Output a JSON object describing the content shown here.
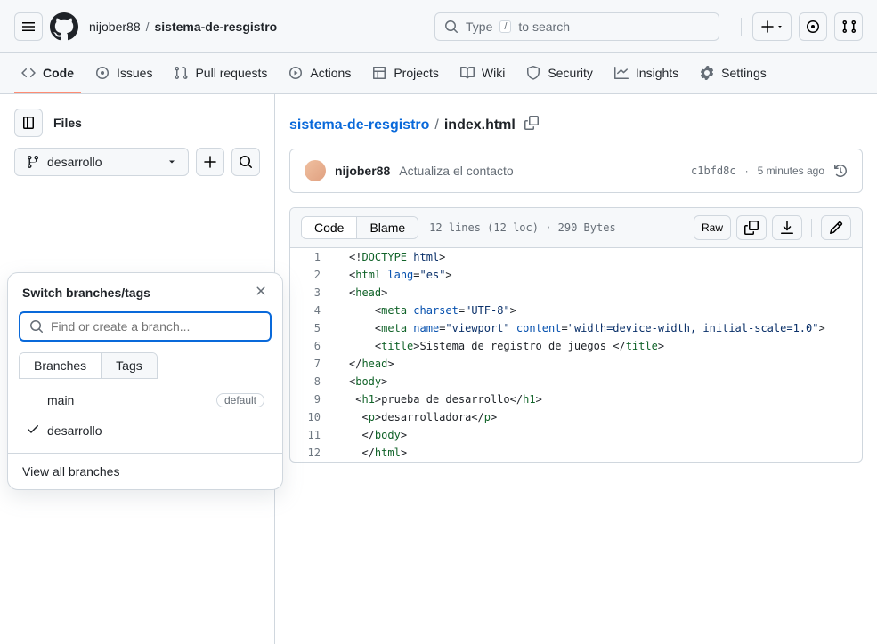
{
  "header": {
    "owner": "nijober88",
    "repo": "sistema-de-resgistro",
    "search_prefix": "Type",
    "search_key": "/",
    "search_suffix": "to search"
  },
  "nav": {
    "code": "Code",
    "issues": "Issues",
    "pulls": "Pull requests",
    "actions": "Actions",
    "projects": "Projects",
    "wiki": "Wiki",
    "security": "Security",
    "insights": "Insights",
    "settings": "Settings"
  },
  "sidebar": {
    "files_label": "Files",
    "current_branch": "desarrollo"
  },
  "branch_popup": {
    "title": "Switch branches/tags",
    "search_placeholder": "Find or create a branch...",
    "tab_branches": "Branches",
    "tab_tags": "Tags",
    "branches": [
      {
        "name": "main",
        "default": true,
        "checked": false
      },
      {
        "name": "desarrollo",
        "default": false,
        "checked": true
      }
    ],
    "default_label": "default",
    "view_all": "View all branches"
  },
  "file": {
    "repo_link": "sistema-de-resgistro",
    "filename": "index.html"
  },
  "commit": {
    "author": "nijober88",
    "message": "Actualiza el contacto",
    "sha": "c1bfd8c",
    "time_sep": " · ",
    "time": "5 minutes ago"
  },
  "code_toolbar": {
    "code_tab": "Code",
    "blame_tab": "Blame",
    "file_info": "12 lines (12 loc) · 290 Bytes",
    "raw": "Raw"
  },
  "code_lines": [
    {
      "n": 1,
      "html": "<span class='pl-kos'>&lt;!</span><span class='pl-ent'>DOCTYPE</span> <span class='pl-s'>html</span><span class='pl-kos'>&gt;</span>"
    },
    {
      "n": 2,
      "html": "<span class='pl-kos'>&lt;</span><span class='pl-ent'>html</span> <span class='pl-c1'>lang</span>=<span class='pl-s'>\"es\"</span><span class='pl-kos'>&gt;</span>"
    },
    {
      "n": 3,
      "html": "<span class='pl-kos'>&lt;</span><span class='pl-ent'>head</span><span class='pl-kos'>&gt;</span>"
    },
    {
      "n": 4,
      "html": "    <span class='pl-kos'>&lt;</span><span class='pl-ent'>meta</span> <span class='pl-c1'>charset</span>=<span class='pl-s'>\"UTF-8\"</span><span class='pl-kos'>&gt;</span>"
    },
    {
      "n": 5,
      "html": "    <span class='pl-kos'>&lt;</span><span class='pl-ent'>meta</span> <span class='pl-c1'>name</span>=<span class='pl-s'>\"viewport\"</span> <span class='pl-c1'>content</span>=<span class='pl-s'>\"width=device-width, initial-scale=1.0\"</span><span class='pl-kos'>&gt;</span>"
    },
    {
      "n": 6,
      "html": "    <span class='pl-kos'>&lt;</span><span class='pl-ent'>title</span><span class='pl-kos'>&gt;</span>Sistema de registro de juegos <span class='pl-kos'>&lt;/</span><span class='pl-ent'>title</span><span class='pl-kos'>&gt;</span>"
    },
    {
      "n": 7,
      "html": "<span class='pl-kos'>&lt;/</span><span class='pl-ent'>head</span><span class='pl-kos'>&gt;</span>"
    },
    {
      "n": 8,
      "html": "<span class='pl-kos'>&lt;</span><span class='pl-ent'>body</span><span class='pl-kos'>&gt;</span>"
    },
    {
      "n": 9,
      "html": " <span class='pl-kos'>&lt;</span><span class='pl-ent'>h1</span><span class='pl-kos'>&gt;</span>prueba de desarrollo<span class='pl-kos'>&lt;/</span><span class='pl-ent'>h1</span><span class='pl-kos'>&gt;</span>"
    },
    {
      "n": 10,
      "html": "  <span class='pl-kos'>&lt;</span><span class='pl-ent'>p</span><span class='pl-kos'>&gt;</span>desarrolladora<span class='pl-kos'>&lt;/</span><span class='pl-ent'>p</span><span class='pl-kos'>&gt;</span>"
    },
    {
      "n": 11,
      "html": "  <span class='pl-kos'>&lt;/</span><span class='pl-ent'>body</span><span class='pl-kos'>&gt;</span>"
    },
    {
      "n": 12,
      "html": "  <span class='pl-kos'>&lt;/</span><span class='pl-ent'>html</span><span class='pl-kos'>&gt;</span>"
    }
  ]
}
